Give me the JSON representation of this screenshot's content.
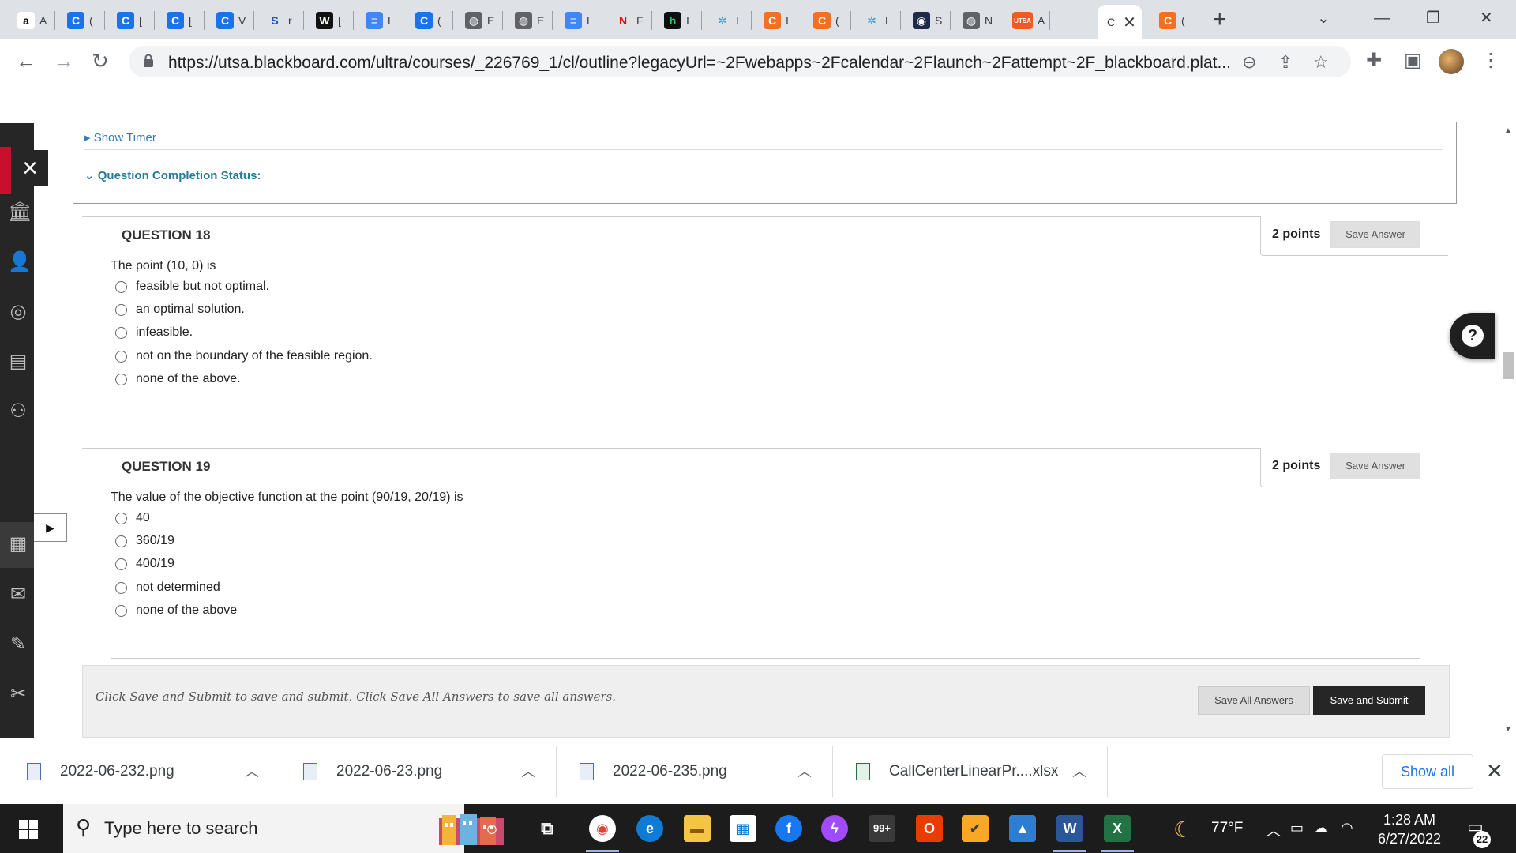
{
  "browser": {
    "tabs": [
      {
        "fav": "a",
        "color": "#ffffff",
        "fg": "#000000",
        "label": "A"
      },
      {
        "fav": "C",
        "color": "#1a73e8",
        "fg": "#ffffff",
        "label": "("
      },
      {
        "fav": "C",
        "color": "#1a73e8",
        "fg": "#ffffff",
        "label": "["
      },
      {
        "fav": "C",
        "color": "#1a73e8",
        "fg": "#ffffff",
        "label": "["
      },
      {
        "fav": "C",
        "color": "#1a73e8",
        "fg": "#ffffff",
        "label": "V"
      },
      {
        "fav": "S",
        "color": "#dee1e6",
        "fg": "#1a4fd6",
        "label": "r"
      },
      {
        "fav": "W",
        "color": "#111111",
        "fg": "#ffffff",
        "label": "["
      },
      {
        "fav": "≡",
        "color": "#4285f4",
        "fg": "#ffffff",
        "label": "L"
      },
      {
        "fav": "C",
        "color": "#1a73e8",
        "fg": "#ffffff",
        "label": "("
      },
      {
        "fav": "◍",
        "color": "#5f6368",
        "fg": "#ffffff",
        "label": "E"
      },
      {
        "fav": "◍",
        "color": "#5f6368",
        "fg": "#ffffff",
        "label": "E"
      },
      {
        "fav": "≡",
        "color": "#4285f4",
        "fg": "#ffffff",
        "label": "L"
      },
      {
        "fav": "N",
        "color": "#dee1e6",
        "fg": "#e50914",
        "label": "F"
      },
      {
        "fav": "h",
        "color": "#0f0f0f",
        "fg": "#3cc46b",
        "label": "I"
      },
      {
        "fav": "✲",
        "color": "#dee1e6",
        "fg": "#34a0d8",
        "label": "L"
      },
      {
        "fav": "C",
        "color": "#f36f21",
        "fg": "#ffffff",
        "label": "I"
      },
      {
        "fav": "C",
        "color": "#f36f21",
        "fg": "#ffffff",
        "label": "("
      },
      {
        "fav": "✲",
        "color": "#dee1e6",
        "fg": "#34a0d8",
        "label": "L"
      },
      {
        "fav": "◉",
        "color": "#1e2a48",
        "fg": "#ffffff",
        "label": "S"
      },
      {
        "fav": "◍",
        "color": "#5f6368",
        "fg": "#ffffff",
        "label": "N"
      },
      {
        "fav": "UTSA",
        "color": "#f15a22",
        "fg": "#ffffff",
        "label": "A"
      }
    ],
    "active_tab_label": "C",
    "last_tab": {
      "fav": "C",
      "color": "#f36f21",
      "label": "("
    },
    "url": "https://utsa.blackboard.com/ultra/courses/_226769_1/cl/outline?legacyUrl=~2Fwebapps~2Fcalendar~2Flaunch~2Fattempt~2F_blackboard.plat..."
  },
  "page": {
    "show_timer": "Show Timer",
    "completion_status": "Question Completion Status:",
    "questions": [
      {
        "title": "QUESTION 18",
        "points": "2 points",
        "save_label": "Save Answer",
        "text": "The point (10, 0) is",
        "options": [
          "feasible but not optimal.",
          "an optimal solution.",
          "infeasible.",
          "not on the boundary of the feasible region.",
          "none of the above."
        ]
      },
      {
        "title": "QUESTION 19",
        "points": "2 points",
        "save_label": "Save Answer",
        "text": "The value of the objective function at the point (90/19, 20/19) is",
        "options": [
          "40",
          "360/19",
          "400/19",
          "not determined",
          "none of the above"
        ]
      }
    ],
    "submit_text": "Click Save and Submit to save and submit. Click Save All Answers to save all answers.",
    "save_all_label": "Save All Answers",
    "save_submit_label": "Save and Submit",
    "help_glyph": "?"
  },
  "downloads": {
    "items": [
      {
        "name": "2022-06-232.png",
        "type": "image"
      },
      {
        "name": "2022-06-23.png",
        "type": "image"
      },
      {
        "name": "2022-06-235.png",
        "type": "image"
      },
      {
        "name": "CallCenterLinearPr....xlsx",
        "type": "excel"
      }
    ],
    "show_all": "Show all"
  },
  "taskbar": {
    "search_placeholder": "Type here to search",
    "mail_badge": "99+",
    "temperature": "77°F",
    "time": "1:28 AM",
    "date": "6/27/2022",
    "notification_count": "22"
  }
}
